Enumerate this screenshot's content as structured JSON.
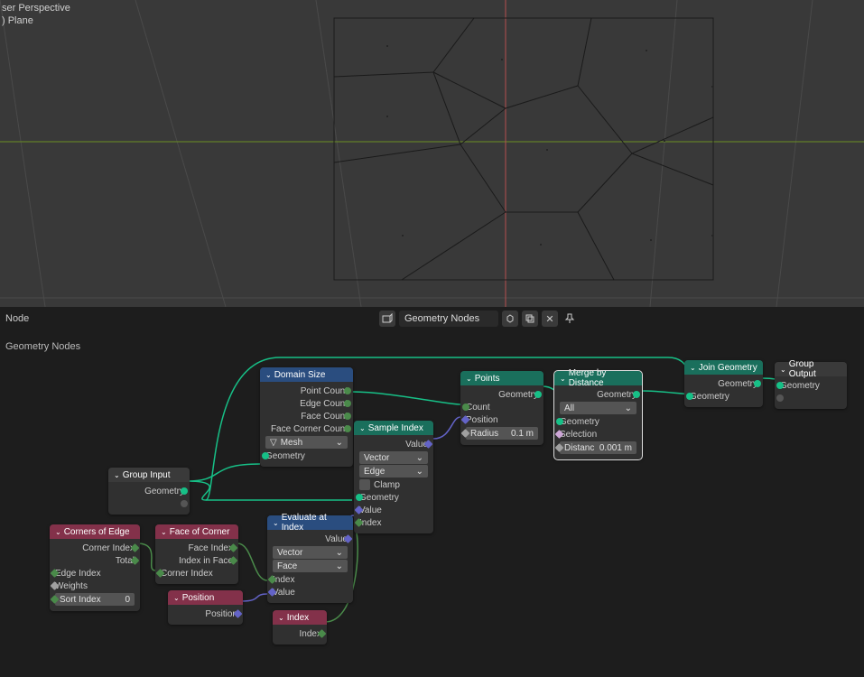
{
  "viewport": {
    "line1": "ser Perspective",
    "line2": ") Plane"
  },
  "header": {
    "left_label": "Node",
    "datablock_name": "Geometry Nodes",
    "icons": {
      "browse": "browse-icon",
      "shield": "shield-icon",
      "duplicate": "duplicate-icon",
      "unlink": "unlink-icon",
      "pin": "pin-icon"
    }
  },
  "editor": {
    "label": "Geometry Nodes"
  },
  "nodes": {
    "group_input": {
      "title": "Group Input",
      "geometry": "Geometry"
    },
    "domain_size": {
      "title": "Domain Size",
      "point_count": "Point Count",
      "edge_count": "Edge Count",
      "face_count": "Face Count",
      "face_corner_count": "Face Corner Count",
      "component": "Mesh",
      "geometry": "Geometry"
    },
    "sample_index": {
      "title": "Sample Index",
      "value_out": "Value",
      "type": "Vector",
      "domain": "Edge",
      "clamp": "Clamp",
      "geometry": "Geometry",
      "value_in": "Value",
      "index": "Index"
    },
    "points": {
      "title": "Points",
      "geometry": "Geometry",
      "count": "Count",
      "position": "Position",
      "radius_label": "Radius",
      "radius_value": "0.1 m"
    },
    "merge": {
      "title": "Merge by Distance",
      "geometry_out": "Geometry",
      "mode": "All",
      "geometry_in": "Geometry",
      "selection": "Selection",
      "distance_label": "Distanc",
      "distance_value": "0.001 m"
    },
    "join": {
      "title": "Join Geometry",
      "geometry_out": "Geometry",
      "geometry_in": "Geometry"
    },
    "group_output": {
      "title": "Group Output",
      "geometry": "Geometry"
    },
    "corners_of_edge": {
      "title": "Corners of Edge",
      "corner_index": "Corner Index",
      "total": "Total",
      "edge_index": "Edge Index",
      "weights": "Weights",
      "sort_index_label": "Sort Index",
      "sort_index_value": "0"
    },
    "face_of_corner": {
      "title": "Face of Corner",
      "face_index": "Face Index",
      "index_in_face": "Index in Face",
      "corner_index": "Corner Index"
    },
    "evaluate_at_index": {
      "title": "Evaluate at Index",
      "value_out": "Value",
      "type": "Vector",
      "domain": "Face",
      "index": "Index",
      "value_in": "Value"
    },
    "position": {
      "title": "Position",
      "position": "Position"
    },
    "index": {
      "title": "Index",
      "index": "Index"
    }
  }
}
